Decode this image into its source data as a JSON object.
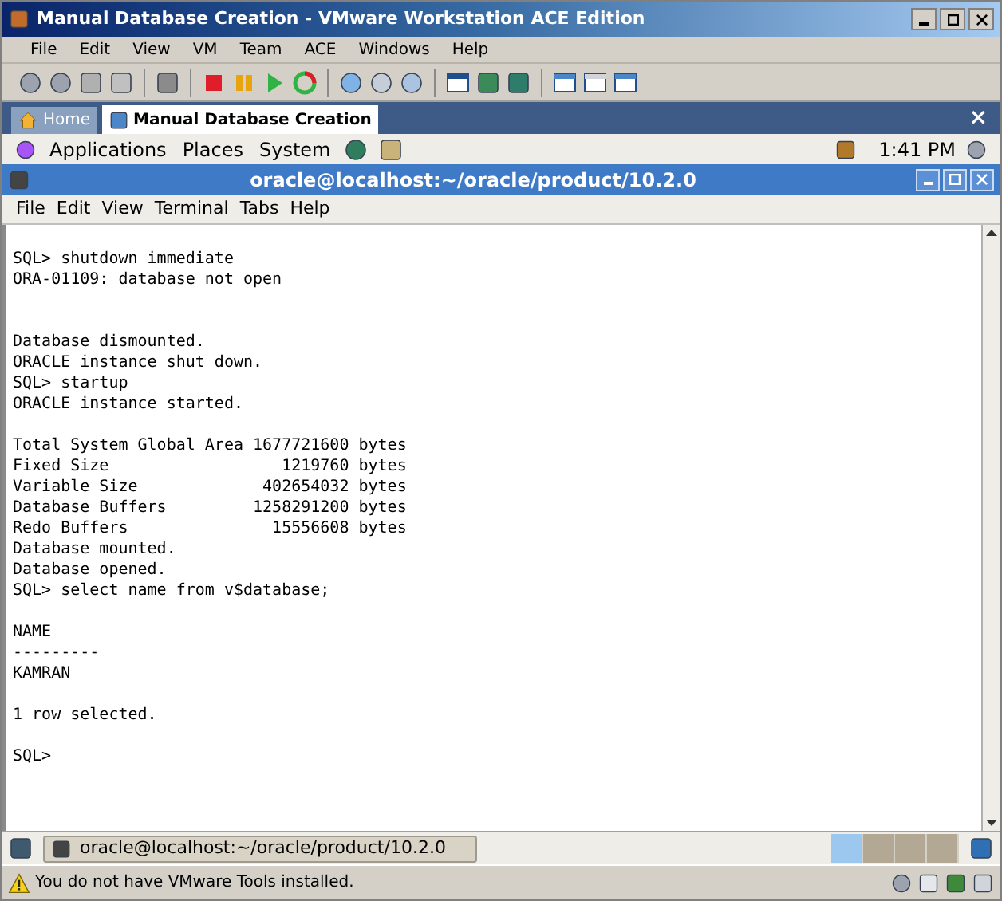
{
  "window": {
    "title": "Manual Database Creation - VMware Workstation ACE Edition"
  },
  "menu": [
    "File",
    "Edit",
    "View",
    "VM",
    "Team",
    "ACE",
    "Windows",
    "Help"
  ],
  "tabs": [
    {
      "label": "Home",
      "selected": false
    },
    {
      "label": "Manual Database Creation",
      "selected": true
    }
  ],
  "tab_close": "×",
  "gnome_panel": {
    "items": [
      "Applications",
      "Places",
      "System"
    ],
    "clock": "1:41 PM"
  },
  "terminal": {
    "title": "oracle@localhost:~/oracle/product/10.2.0",
    "menu": [
      "File",
      "Edit",
      "View",
      "Terminal",
      "Tabs",
      "Help"
    ],
    "blocks": [
      {
        "extra_gap": false,
        "lines": [
          "SQL> shutdown immediate",
          "ORA-01109: database not open"
        ]
      },
      {
        "extra_gap": true,
        "lines": [
          "Database dismounted.",
          "ORACLE instance shut down.",
          "SQL> startup",
          "ORACLE instance started."
        ]
      },
      {
        "extra_gap": false,
        "lines": [
          "Total System Global Area 1677721600 bytes",
          "Fixed Size                  1219760 bytes",
          "Variable Size             402654032 bytes",
          "Database Buffers         1258291200 bytes",
          "Redo Buffers               15556608 bytes",
          "Database mounted.",
          "Database opened.",
          "SQL> select name from v$database;"
        ]
      },
      {
        "extra_gap": false,
        "lines": [
          "NAME",
          "---------",
          "KAMRAN"
        ]
      },
      {
        "extra_gap": false,
        "lines": [
          "1 row selected."
        ]
      },
      {
        "extra_gap": false,
        "lines": [
          "SQL>"
        ]
      }
    ]
  },
  "taskbar": {
    "window_button": "oracle@localhost:~/oracle/product/10.2.0",
    "workspaces": [
      {
        "selected": true
      },
      {
        "selected": false
      },
      {
        "selected": false
      },
      {
        "selected": false
      }
    ]
  },
  "status_bar": {
    "message": "You do not have VMware Tools installed."
  }
}
